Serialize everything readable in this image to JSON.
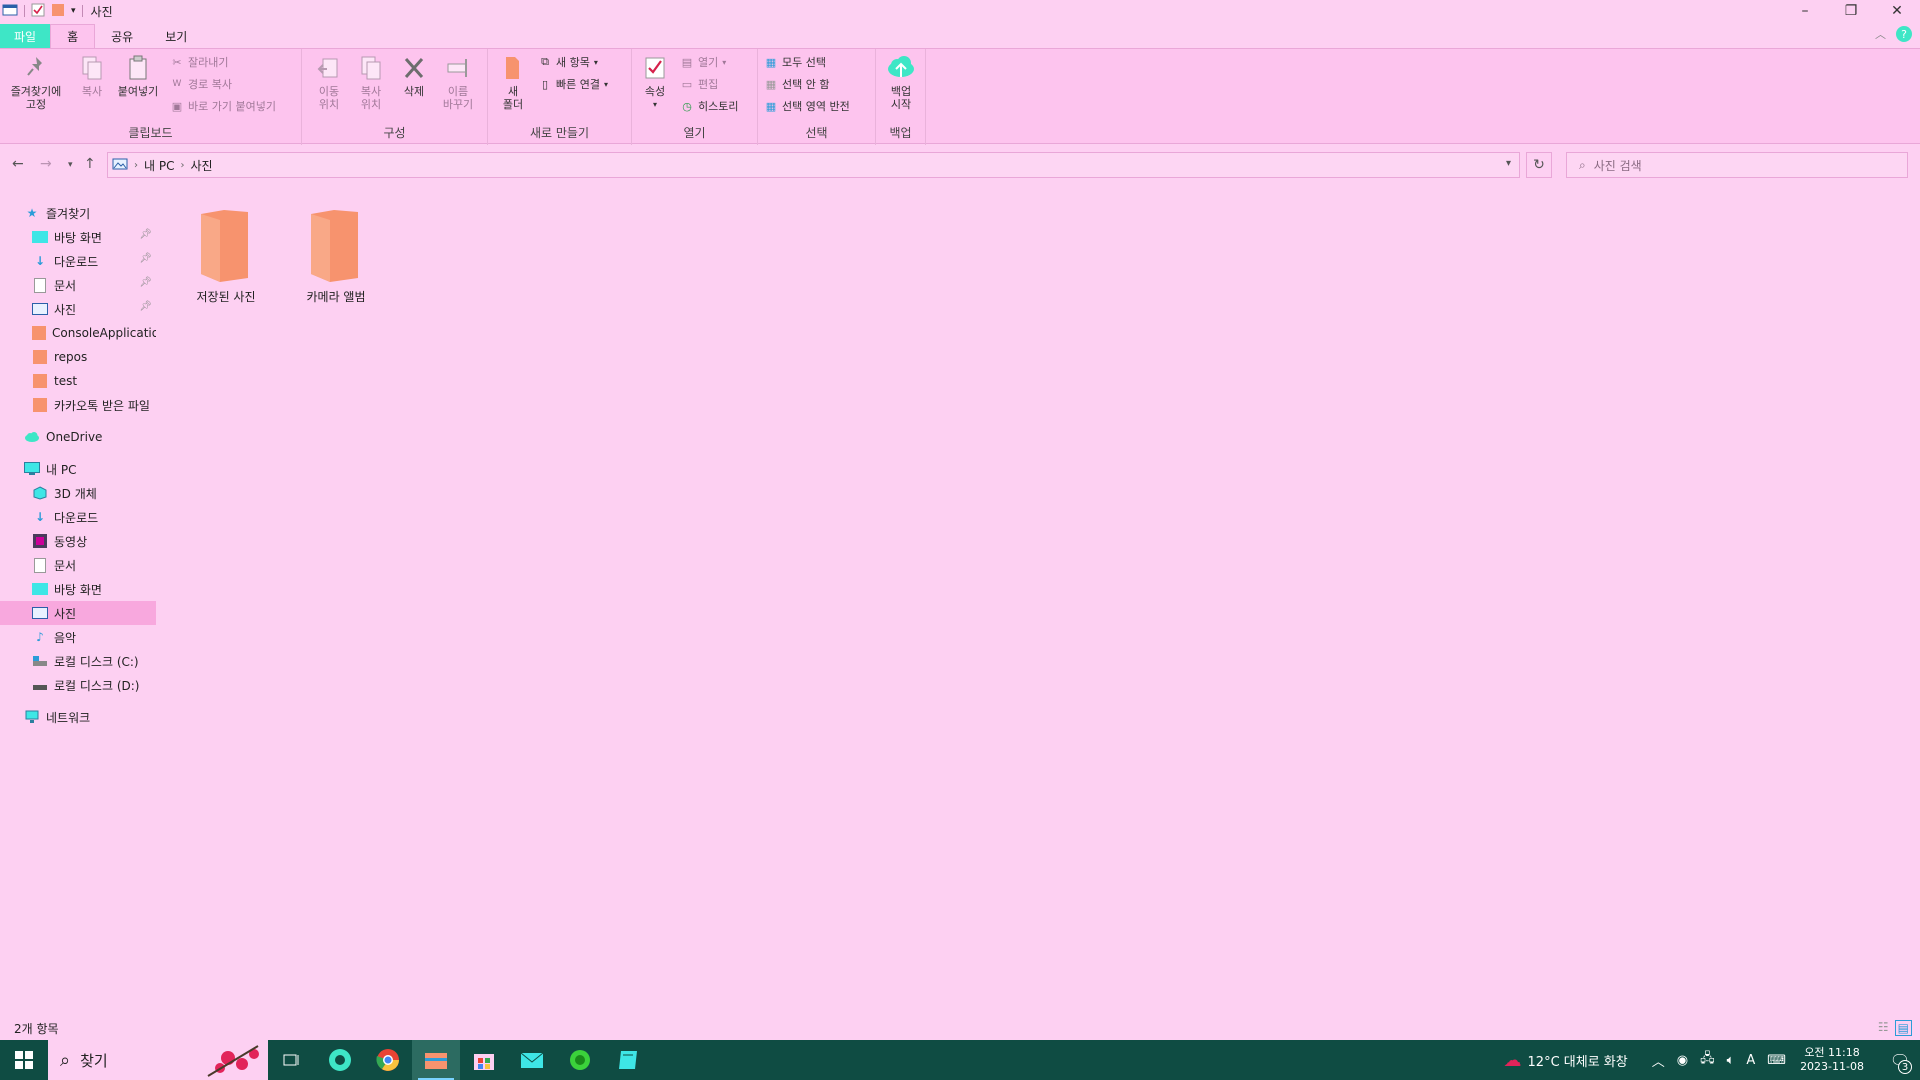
{
  "window": {
    "title": "사진"
  },
  "ribbon_tabs": [
    "파일",
    "홈",
    "공유",
    "보기"
  ],
  "ribbon": {
    "clipboard": {
      "label": "클립보드",
      "pin": "즐겨찾기에\n고정",
      "copy": "복사",
      "paste": "붙여넣기",
      "cut": "잘라내기",
      "copy_path": "경로 복사",
      "paste_shortcut": "바로 가기 붙여넣기"
    },
    "organize": {
      "label": "구성",
      "move_to": "이동\n위치",
      "copy_to": "복사\n위치",
      "delete": "삭제",
      "rename": "이름\n바꾸기"
    },
    "new": {
      "label": "새로 만들기",
      "new_folder": "새\n폴더",
      "new_item": "새 항목",
      "easy_access": "빠른 연결"
    },
    "open": {
      "label": "열기",
      "properties": "속성",
      "open": "열기",
      "edit": "편집",
      "history": "히스토리"
    },
    "select": {
      "label": "선택",
      "select_all": "모두 선택",
      "select_none": "선택 안 함",
      "invert": "선택 영역 반전"
    },
    "backup": {
      "label": "백업",
      "start": "백업\n시작"
    }
  },
  "address": {
    "crumbs": [
      "내 PC",
      "사진"
    ],
    "search_placeholder": "사진 검색"
  },
  "navpane": {
    "quick_access": "즐겨찾기",
    "quick_items": [
      {
        "label": "바탕 화면",
        "icon": "desktop-icon",
        "pinned": true
      },
      {
        "label": "다운로드",
        "icon": "download-icon",
        "pinned": true
      },
      {
        "label": "문서",
        "icon": "document-icon",
        "pinned": true
      },
      {
        "label": "사진",
        "icon": "pictures-icon",
        "pinned": true
      },
      {
        "label": "ConsoleApplication",
        "icon": "folder-icon",
        "pinned": false
      },
      {
        "label": "repos",
        "icon": "folder-icon",
        "pinned": false
      },
      {
        "label": "test",
        "icon": "folder-icon",
        "pinned": false
      },
      {
        "label": "카카오톡 받은 파일",
        "icon": "folder-icon",
        "pinned": false
      }
    ],
    "onedrive": "OneDrive",
    "this_pc": "내 PC",
    "pc_items": [
      {
        "label": "3D 개체",
        "icon": "3d-objects-icon"
      },
      {
        "label": "다운로드",
        "icon": "download-icon"
      },
      {
        "label": "동영상",
        "icon": "video-icon"
      },
      {
        "label": "문서",
        "icon": "document-icon"
      },
      {
        "label": "바탕 화면",
        "icon": "desktop-icon"
      },
      {
        "label": "사진",
        "icon": "pictures-icon"
      },
      {
        "label": "음악",
        "icon": "music-icon"
      },
      {
        "label": "로컬 디스크 (C:)",
        "icon": "drive-c-icon"
      },
      {
        "label": "로컬 디스크 (D:)",
        "icon": "drive-d-icon"
      }
    ],
    "network": "네트워크"
  },
  "content": {
    "folders": [
      "저장된 사진",
      "카메라 앨범"
    ]
  },
  "status": {
    "count": "2개 항목"
  },
  "taskbar": {
    "search": "찾기",
    "weather": "12°C  대체로 화창",
    "time": "오전 11:18",
    "date": "2023-11-08",
    "notif_count": "3",
    "ime": "A"
  },
  "colors": {
    "background": "#fdd0f2",
    "ribbon": "#fdc4ee",
    "accent": "#3ee6c6",
    "folder": "#f7936e",
    "taskbar": "#0f4c43"
  }
}
